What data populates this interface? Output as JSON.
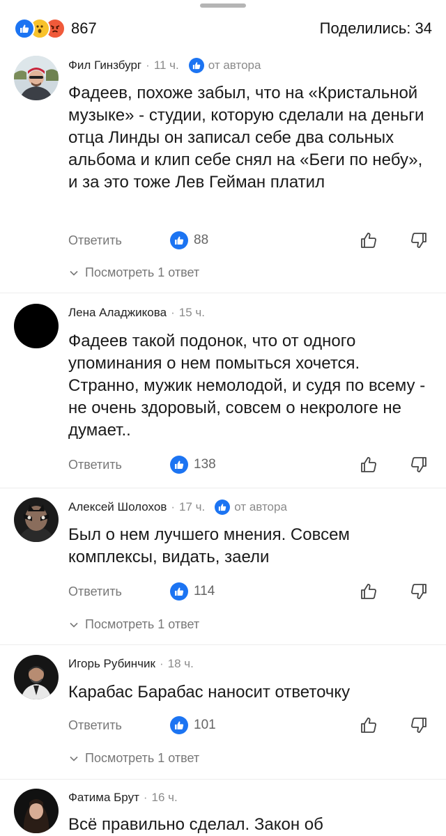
{
  "header": {
    "reaction_count": "867",
    "shared_label": "Поделились: 34"
  },
  "comments": [
    {
      "author": "Фил Гинзбург",
      "time": "11 ч.",
      "by_author_label": "от автора",
      "text": "Фадеев, похоже забыл, что на «Кристальной музыке» - студии, которую сделали на деньги отца Линды он записал себе два сольных альбома и клип себе снял на «Беги по небу», и за это тоже Лев Гейман платил",
      "reply_label": "Ответить",
      "likes": "88",
      "replies_label": "Посмотреть 1 ответ"
    },
    {
      "author": "Лена Аладжикова",
      "time": "15 ч.",
      "text": "Фадеев такой подонок, что от одного упоминания о нем помыться хочется. Странно, мужик немолодой, и судя по всему - не очень здоровый, совсем о некрологе не думает..",
      "reply_label": "Ответить",
      "likes": "138"
    },
    {
      "author": "Алексей Шолохов",
      "time": "17 ч.",
      "by_author_label": "от автора",
      "text": "Был о нем лучшего мнения. Совсем комплексы, видать, заели",
      "reply_label": "Ответить",
      "likes": "114",
      "replies_label": "Посмотреть 1 ответ"
    },
    {
      "author": "Игорь Рубинчик",
      "time": "18 ч.",
      "text": "Карабас Барабас наносит ответочку",
      "reply_label": "Ответить",
      "likes": "101",
      "replies_label": "Посмотреть 1 ответ"
    },
    {
      "author": "Фатима Брут",
      "time": "16 ч.",
      "text": "Всё правильно сделал. Закон об"
    }
  ],
  "colors": {
    "accent": "#1c74f2",
    "muted": "#8a8a8a"
  }
}
